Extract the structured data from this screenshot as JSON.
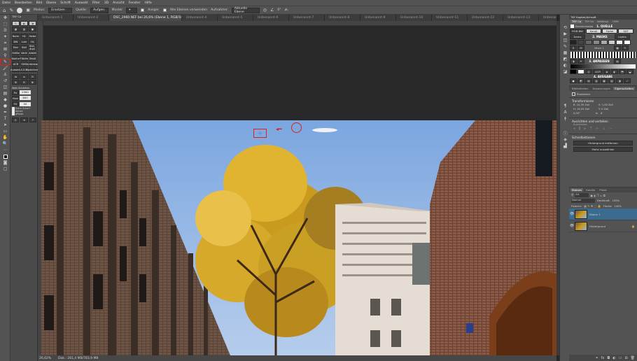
{
  "menu": [
    "Datei",
    "Bearbeiten",
    "Bild",
    "Ebene",
    "Schrift",
    "Auswahl",
    "Filter",
    "3D",
    "Ansicht",
    "Fenster",
    "Hilfe"
  ],
  "options": {
    "modus_label": "Modus:",
    "modus_value": "Ersetzen",
    "quelle_label": "Quelle:",
    "quelle_aufgen": "Aufgen.",
    "quelle_muster": "Muster",
    "ausger": "Ausger.",
    "alle_ebenen": "Alle Ebenen verwenden",
    "aufnahme_label": "Aufnahme:",
    "aufnahme_value": "Aktuelle Ebene",
    "angle": "0°"
  },
  "tabs": [
    {
      "label": "Unbenannt-1",
      "active": false
    },
    {
      "label": "Unbenannt-2",
      "active": false
    },
    {
      "label": "DSC_2960.NEF bei 26,6% (Ebene 1, RGB/16)",
      "active": true
    },
    {
      "label": "Unbenannt-4",
      "active": false
    },
    {
      "label": "Unbenannt-5",
      "active": false
    },
    {
      "label": "Unbenannt-6",
      "active": false
    },
    {
      "label": "Unbenannt-7",
      "active": false
    },
    {
      "label": "Unbenannt-8",
      "active": false
    },
    {
      "label": "Unbenannt-9",
      "active": false
    },
    {
      "label": "Unbenannt-10",
      "active": false
    },
    {
      "label": "Unbenannt-11",
      "active": false
    },
    {
      "label": "Unbenannt-12",
      "active": false
    },
    {
      "label": "Unbenannt-13",
      "active": false
    },
    {
      "label": "Unbenannt-14",
      "active": false
    },
    {
      "label": "Unbenannt-15",
      "active": false
    }
  ],
  "tky": {
    "title": "TKY Co",
    "buttons": [
      "Norm",
      "HL",
      "Farbe",
      "BW",
      "Lum",
      "HL",
      "Sinn",
      "Bell",
      "Bild dupl",
      "Größe",
      "Verkl",
      "Arbeit",
      "Kontur",
      "Fläche",
      "Dauß",
      "ACR",
      "SMO",
      "Unterstau",
      "Auswahl",
      "A.S.M",
      "Speichern"
    ],
    "web_label": "Web Schärfen",
    "px_label": "Px",
    "web_value1": "2560",
    "horiz": "Horz",
    "web_value2": "800",
    "px2": "FX",
    "sharp_value": "50",
    "extra_scharf": "Extra Scharf",
    "aktiv": "Aktive",
    "pfeile": "pPaste"
  },
  "status": {
    "zoom": "26,62%",
    "doc": "Dok.: 261,4 MB/783,9 MB"
  },
  "kapitel": {
    "title": "TKY Kapitel/Achsoft",
    "tabs": [
      "TKY Co",
      "TKY Ko",
      "Weitergr.",
      "Hilfe"
    ],
    "ebene_label": "Ebenenmaske",
    "quelle": "1. QUELLE",
    "rgb_btn": "RGB-BW",
    "kanal": "Kanal",
    "farbe": "Farbe",
    "sat": "SAT",
    "darks": "Darks",
    "masken": "2. MASKE",
    "lights": "Lights",
    "anpassen": "3. ANPASSEN",
    "ausgabe": "4. AUSGABE",
    "acr": "ACR",
    "sm": "S",
    "mm": "M",
    "misch": "Misch 1"
  },
  "props": {
    "tabs": [
      "Bibliotheken",
      "Anpassungen",
      "Eigenschaften"
    ],
    "pixel_ebene": "Pixelebene",
    "transform": "Transformieren",
    "w": "B: 24,39 Zoll",
    "x": "X: 1,00 Zoll",
    "h": "H: 16,05 Zoll",
    "y": "Y: 0 Zoll",
    "angle": "0,00°",
    "ausrichten": "Ausrichten und verteilen",
    "ausrichten_sub": "Ausrichten:",
    "schnell": "Schnellaktionen",
    "hg_entfernen": "Hintergrund entfernen",
    "motiv": "Motiv auswählen"
  },
  "layers": {
    "tabs": [
      "Ebenen",
      "Kanäle",
      "Pfade"
    ],
    "art": "Art",
    "mode": "Normal",
    "deckkraft_label": "Deckkraft:",
    "deckkraft": "100%",
    "fixieren": "Fixieren:",
    "flaeche_label": "Fläche:",
    "flaeche": "100%",
    "items": [
      {
        "name": "Ebene 1",
        "selected": true,
        "italic": false
      },
      {
        "name": "Hintergrund",
        "selected": false,
        "italic": true
      }
    ]
  }
}
